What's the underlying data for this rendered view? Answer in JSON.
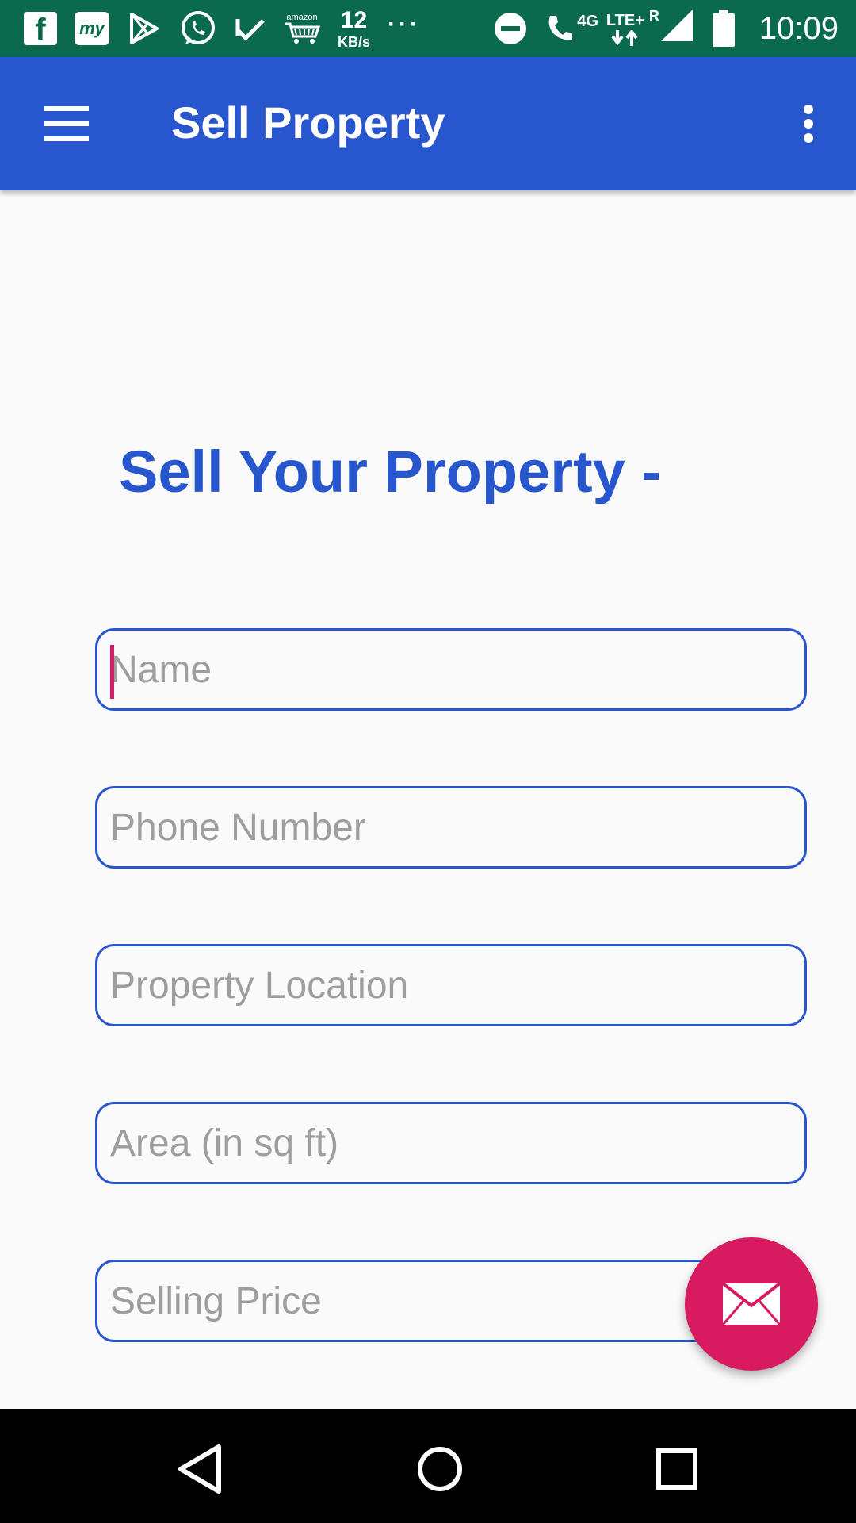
{
  "status_bar": {
    "facebook_glyph": "f",
    "myapp_label": "my",
    "amazon_label": "amazon",
    "speed_value": "12",
    "speed_unit": "KB/s",
    "overflow_dots": "···",
    "network_4g": "4G",
    "network_lte": "LTE+",
    "roaming": "R",
    "time": "10:09"
  },
  "app_bar": {
    "title": "Sell Property"
  },
  "form": {
    "heading": "Sell Your Property -",
    "fields": [
      {
        "placeholder": "Name",
        "value": ""
      },
      {
        "placeholder": "Phone Number",
        "value": ""
      },
      {
        "placeholder": "Property Location",
        "value": ""
      },
      {
        "placeholder": "Area (in sq ft)",
        "value": ""
      },
      {
        "placeholder": "Selling Price",
        "value": ""
      }
    ]
  },
  "fab": {
    "icon": "mail-icon"
  },
  "nav_bar": {
    "icons": [
      "back-icon",
      "home-icon",
      "recents-icon"
    ]
  },
  "colors": {
    "status_bar": "#0b6a4e",
    "primary": "#2856cc",
    "accent": "#d81b60",
    "background": "#fafafa"
  }
}
